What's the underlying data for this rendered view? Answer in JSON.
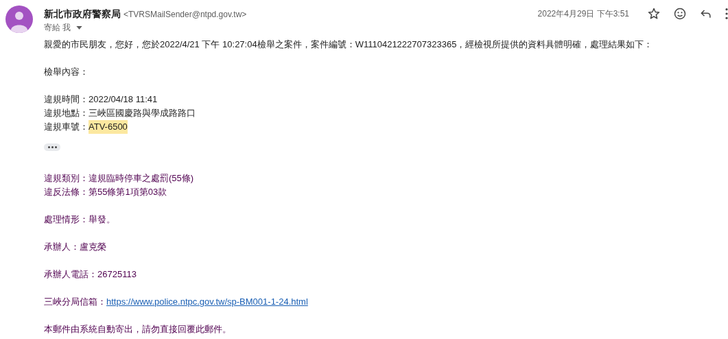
{
  "sender": {
    "name": "新北市政府警察局",
    "email": "<TVRSMailSender@ntpd.gov.tw>",
    "recipient": "寄給 我",
    "date": "2022年4月29日 下午3:51"
  },
  "body": [
    [
      {
        "kind": "text",
        "text": "親愛的市民朋友，您好，您於2022/4/21 下午 10:27:04檢舉之案件，案件編號：W1110421222707323365，經檢視所提供的資料具體明確，處理結果如下："
      }
    ],
    [
      {
        "kind": "text",
        "text": "檢舉內容："
      }
    ],
    [
      {
        "kind": "text",
        "text": "違規時間：2022/04/18 11:41"
      },
      {
        "kind": "text",
        "text": "違規地點：三峽區國慶路與學成路路口"
      },
      {
        "kind": "highlight",
        "label": "違規車號：",
        "value": "ATV-6500"
      }
    ]
  ],
  "quoted": [
    [
      {
        "kind": "text",
        "text": "違規類別：違規臨時停車之處罰(55條)"
      },
      {
        "kind": "text",
        "text": "違反法條：第55條第1項第03款"
      }
    ],
    [
      {
        "kind": "text",
        "text": "處理情形：舉發。"
      }
    ],
    [
      {
        "kind": "text",
        "text": "承辦人：盧克榮"
      }
    ],
    [
      {
        "kind": "text",
        "text": "承辦人電話：26725113"
      }
    ],
    [
      {
        "kind": "link",
        "label": "三峽分局信箱：",
        "value": "https://www.police.ntpc.gov.tw/sp-BM001-1-24.html"
      }
    ],
    [
      {
        "kind": "text",
        "text": "本郵件由系統自動寄出，請勿直接回覆此郵件。"
      }
    ]
  ]
}
